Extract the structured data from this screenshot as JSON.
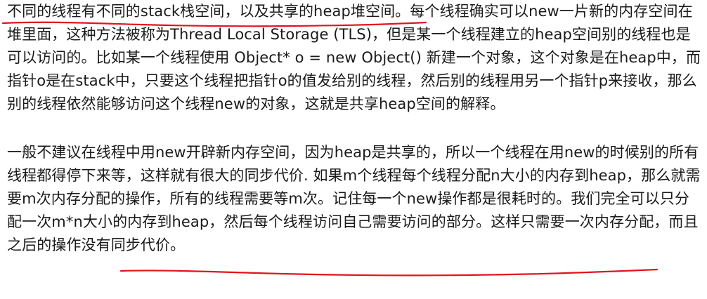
{
  "paragraphs": [
    {
      "underlined": "不同的线程有不同的stack栈空间，以及共享的heap堆空间。",
      "rest": "每个线程确实可以new一片新的内存空间在堆里面，这种方法被称为Thread Local Storage (TLS)，但是某一个线程建立的heap空间别的线程也是可以访问的。比如某一个线程使用 Object* o = new Object() 新建一个对象，这个对象是在heap中，而指针o是在stack中，只要这个线程把指针o的值发给别的线程，然后别的线程用另一个指针p来接收，那么别的线程依然能够访问这个线程new的对象，这就是共享heap空间的解释。"
    },
    {
      "before": "一般不建议在线程中用new开辟新内存空间，因为heap是共享的，所以一个线程在用new的时候别的所有线程都得停下来等，这样就有很大的同步代价. 如果m个线程每个线程分配n大小的内存到heap，那么就需要m次内存分配的操作，所有的线程需要等m次。记住每一个new操作都是很耗时的。我们完全可以",
      "underlined": "只分配一次m*n大小的内存到heap，然后每个线程访问自己需要访问的部分",
      "after": "。这样只需要一次内存分配，而且之后的操作没有同步代价。"
    }
  ],
  "annotation": {
    "color": "#e0141e",
    "kind": "handwritten-underline"
  }
}
